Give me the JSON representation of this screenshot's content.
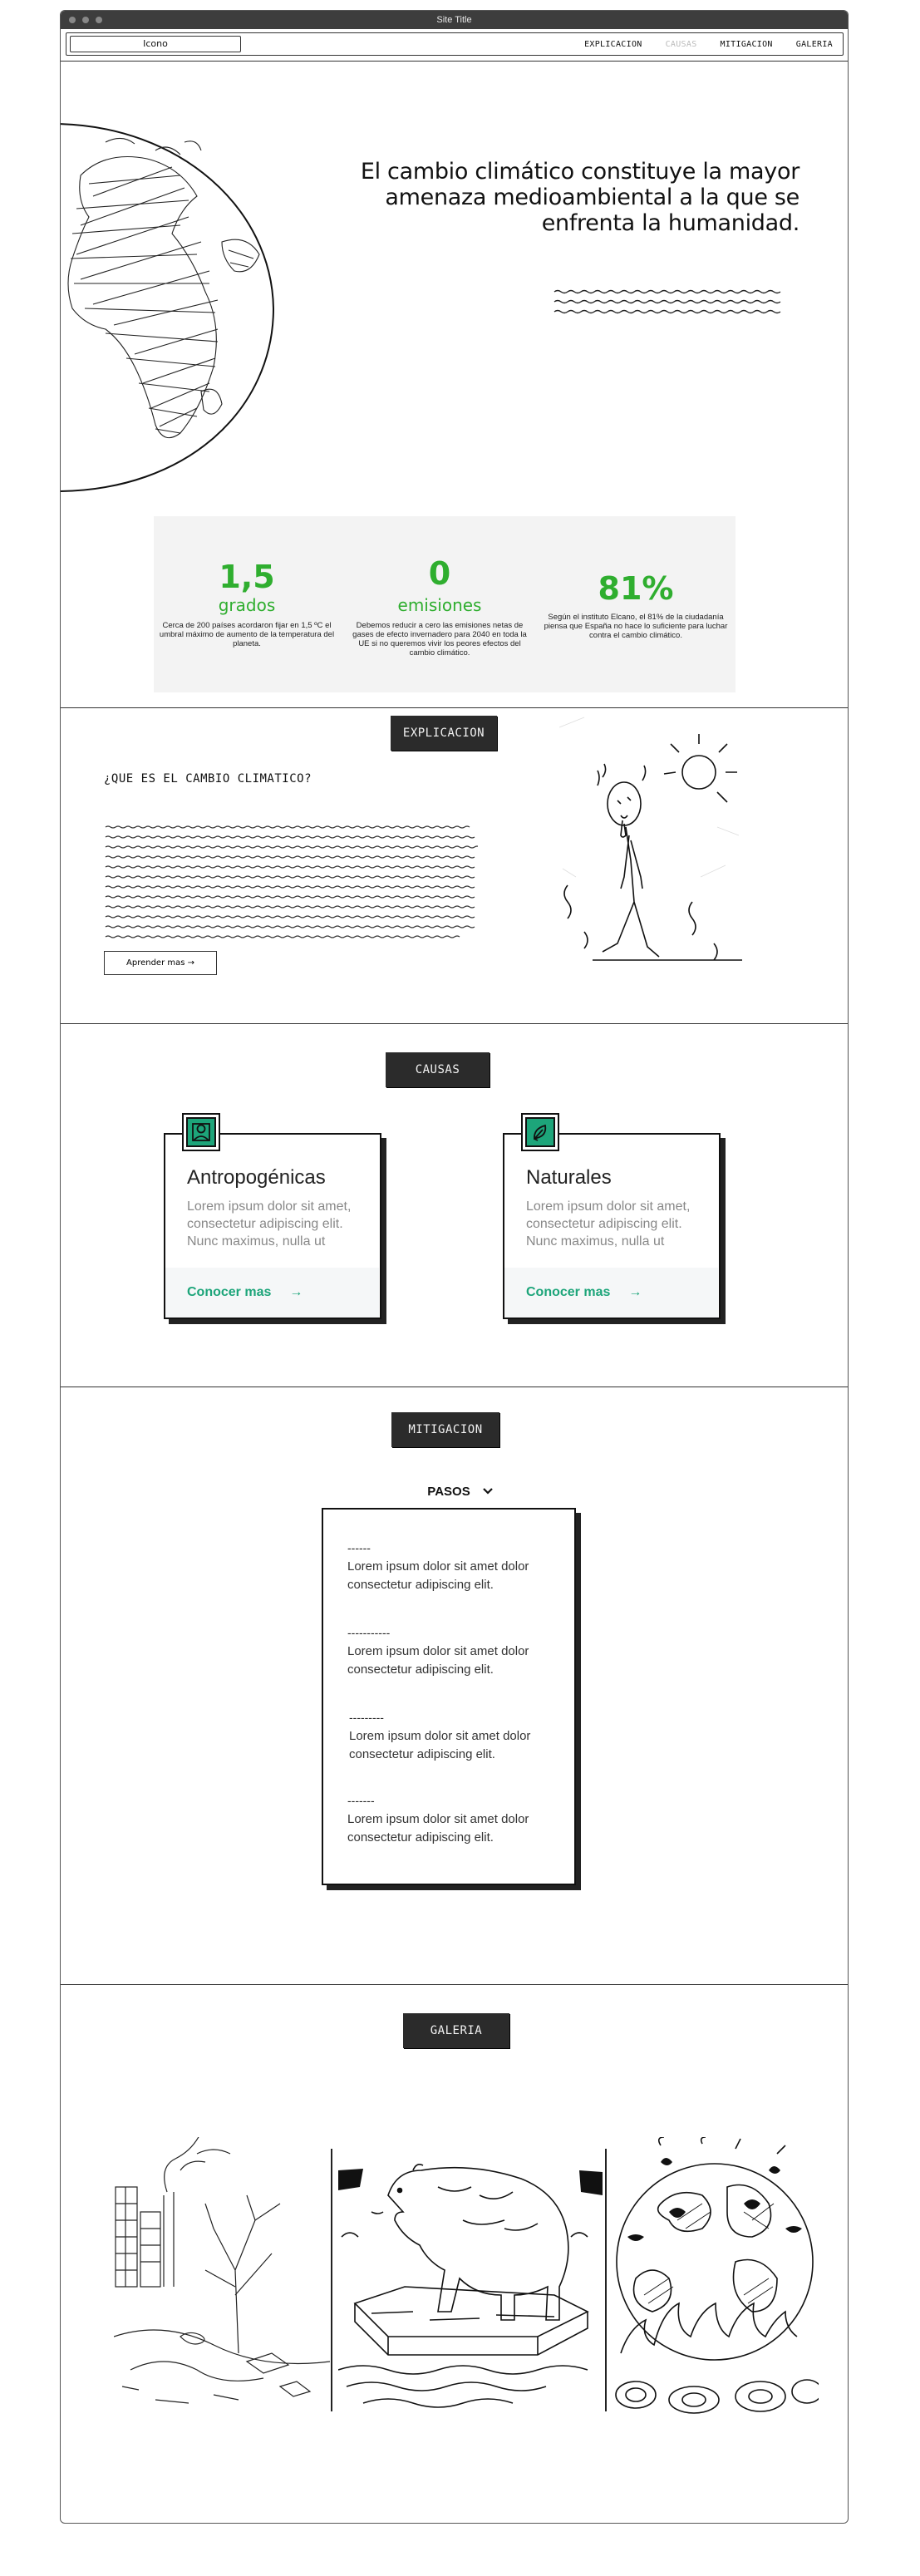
{
  "window": {
    "title": "Site Title"
  },
  "nav": {
    "logo": "Icono",
    "links": [
      {
        "label": "EXPLICACION",
        "active": false
      },
      {
        "label": "CAUSAS",
        "active": true
      },
      {
        "label": "MITIGACION",
        "active": false
      },
      {
        "label": "GALERIA",
        "active": false
      }
    ]
  },
  "hero": {
    "headline": "El cambio climático constituye la mayor amenaza medioambiental a la que se enfrenta la humanidad."
  },
  "stats": [
    {
      "number": "1,5",
      "unit": "grados",
      "description": "Cerca de 200 países acordaron fijar en 1,5 ºC el umbral máximo de aumento de la temperatura del planeta."
    },
    {
      "number": "0",
      "unit": "emisiones",
      "description": "Debemos reducir a cero las emisiones netas de gases de efecto invernadero para 2040 en toda la UE si no queremos vivir los peores efectos del cambio climático."
    },
    {
      "number": "81%",
      "unit": "",
      "description": "Según el instituto Elcano, el 81% de la ciudadanía piensa que España no hace lo suficiente para luchar contra el cambio climático."
    }
  ],
  "explicacion": {
    "chip": "EXPLICACION",
    "question": "¿QUE ES EL CAMBIO CLIMATICO?",
    "button": "Aprender mas →"
  },
  "causas": {
    "chip": "CAUSAS",
    "cards": [
      {
        "title": "Antropogénicas",
        "text": "Lorem ipsum dolor sit amet, consectetur adipiscing elit. Nunc maximus, nulla ut",
        "link": "Conocer mas",
        "arrow": "→",
        "icon": "person-icon"
      },
      {
        "title": "Naturales",
        "text": "Lorem ipsum dolor sit amet, consectetur adipiscing elit. Nunc maximus, nulla ut",
        "link": "Conocer mas",
        "arrow": "→",
        "icon": "leaf-icon"
      }
    ]
  },
  "mitigacion": {
    "chip": "MITIGACION",
    "dropdown": "PASOS",
    "dropdown_icon": "chevron-down-icon",
    "steps": [
      {
        "dash": "------",
        "text": "Lorem ipsum dolor sit amet dolor consectetur adipiscing elit."
      },
      {
        "dash": "-----------",
        "text": "Lorem ipsum dolor sit amet dolor consectetur adipiscing elit."
      },
      {
        "dash": "---------",
        "text": "Lorem ipsum dolor sit amet dolor consectetur adipiscing elit."
      },
      {
        "dash": "-------",
        "text": "Lorem ipsum dolor sit amet dolor consectetur adipiscing elit."
      }
    ]
  },
  "galeria": {
    "chip": "GALERIA"
  },
  "colors": {
    "accent_green": "#2fae2f",
    "teal": "#1da57a",
    "chip_bg": "#2b2b2b"
  }
}
